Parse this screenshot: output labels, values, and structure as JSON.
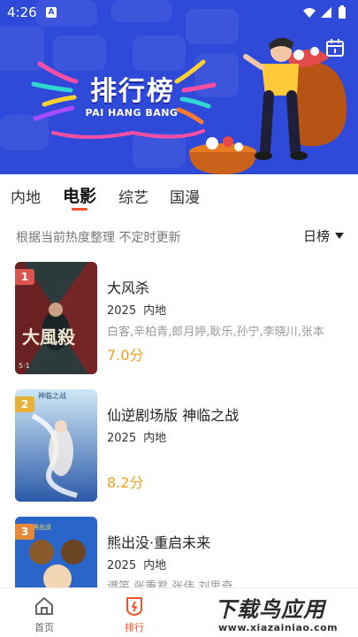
{
  "status_bar": {
    "time": "4:26",
    "notification_letter": "A"
  },
  "banner": {
    "title": "排行榜",
    "subtitle": "PAI HANG BANG"
  },
  "tabs": [
    {
      "label": "内地",
      "active": false
    },
    {
      "label": "电影",
      "active": true
    },
    {
      "label": "综艺",
      "active": false
    },
    {
      "label": "国漫",
      "active": false
    }
  ],
  "subheader": {
    "note": "根据当前热度整理 不定时更新",
    "sort_label": "日榜"
  },
  "items": [
    {
      "rank": "1",
      "title": "大风杀",
      "year": "2025",
      "region": "内地",
      "cast": "白客,辛柏青,郎月婷,耿乐,孙宁,李晓川,张本",
      "score": "7.0分",
      "rank_color": "#d9534f"
    },
    {
      "rank": "2",
      "title": "仙逆剧场版 神临之战",
      "year": "2025",
      "region": "内地",
      "cast": "",
      "score": "8.2分",
      "rank_color": "#e8b23a"
    },
    {
      "rank": "3",
      "title": "熊出没·重启未来",
      "year": "2025",
      "region": "内地",
      "cast": "谭笑,张秉君,张伟,刘思奇",
      "score": "",
      "rank_color": "#e8893a"
    }
  ],
  "bottom_nav": [
    {
      "label": "首页",
      "icon": "home-icon",
      "active": false
    },
    {
      "label": "排行",
      "icon": "ranking-icon",
      "active": true
    }
  ],
  "watermark": {
    "line1": "下载鸟应用",
    "line2": "www.xiazainiao.com"
  },
  "colors": {
    "accent": "#f2532a",
    "banner": "#2f49d9",
    "score": "#f2a024"
  }
}
